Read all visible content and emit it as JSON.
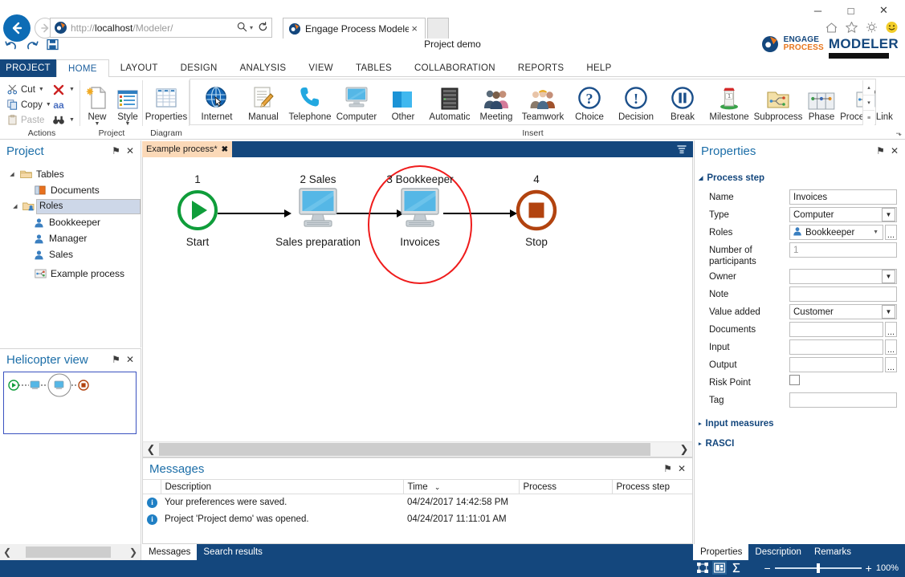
{
  "browser": {
    "url_prefix": "http://",
    "url_host": "localhost",
    "url_suffix": "/Modeler/",
    "url_full": "http://localhost/Modeler/",
    "tab_title": "Engage Process Modeler",
    "tab_close": "×",
    "back_icon": "←",
    "forward_icon": "→",
    "search_icon": "⌕",
    "caret_icon": "▾",
    "refresh_icon": "↻",
    "minimize": "─",
    "maximize": "□",
    "close": "✕",
    "home_icon": "⌂",
    "favorites_icon": "☆",
    "settings_icon": "⚙",
    "smiley_icon": "☺"
  },
  "app": {
    "project_demo": "Project demo",
    "brand_line1": "ENGAGE",
    "brand_line2": "PROCESS",
    "brand_modeler": "MODELER",
    "undo_icon": "↶",
    "redo_icon": "↷",
    "save_icon": "Ὃe"
  },
  "ribbon": {
    "tabs": [
      {
        "label": "PROJECT",
        "state": "project"
      },
      {
        "label": "HOME",
        "state": "active"
      },
      {
        "label": "LAYOUT",
        "state": ""
      },
      {
        "label": "DESIGN",
        "state": ""
      },
      {
        "label": "ANALYSIS",
        "state": ""
      },
      {
        "label": "VIEW",
        "state": ""
      },
      {
        "label": "TABLES",
        "state": ""
      },
      {
        "label": "COLLABORATION",
        "state": ""
      },
      {
        "label": "REPORTS",
        "state": ""
      },
      {
        "label": "HELP",
        "state": ""
      }
    ],
    "groups": {
      "actions": {
        "label": "Actions",
        "cut": "Cut",
        "copy": "Copy",
        "paste": "Paste",
        "delete_icon": "✕",
        "font_icon": "aa",
        "find_icon": "🔭"
      },
      "project": {
        "label": "Project",
        "new": "New",
        "style": "Style"
      },
      "diagram": {
        "label": "Diagram",
        "properties": "Properties"
      },
      "insert": {
        "label": "Insert",
        "items": [
          {
            "label": "Internet",
            "icon": "globe-icon"
          },
          {
            "label": "Manual",
            "icon": "manual-icon"
          },
          {
            "label": "Telephone",
            "icon": "telephone-icon"
          },
          {
            "label": "Computer",
            "icon": "computer-icon"
          },
          {
            "label": "Other",
            "icon": "other-icon"
          },
          {
            "label": "Automatic",
            "icon": "server-icon"
          },
          {
            "label": "Meeting",
            "icon": "meeting-icon"
          },
          {
            "label": "Teamwork",
            "icon": "teamwork-icon"
          },
          {
            "label": "Choice",
            "icon": "question-icon"
          },
          {
            "label": "Decision",
            "icon": "exclamation-icon"
          },
          {
            "label": "Break",
            "icon": "pause-icon"
          },
          {
            "label": "Milestone",
            "icon": "milestone-icon"
          },
          {
            "label": "Subprocess",
            "icon": "subprocess-icon"
          },
          {
            "label": "Phase",
            "icon": "phase-icon"
          },
          {
            "label": "Process Link",
            "icon": "process-link-icon"
          }
        ]
      }
    },
    "scroll_up": "▴",
    "scroll_down": "▾",
    "scroll_more": "≡",
    "dialog_launcher": "⬎"
  },
  "project_panel": {
    "title": "Project",
    "pin_icon": "⚑",
    "close_icon": "✕",
    "tree": [
      {
        "label": "Tables",
        "depth": 0,
        "arrow": "◢",
        "icon": "folder-icon",
        "selected": false
      },
      {
        "label": "Documents",
        "depth": 1,
        "arrow": "",
        "icon": "table-icon",
        "selected": false
      },
      {
        "label": "Roles",
        "depth": 1,
        "arrow": "◢",
        "icon": "roles-table-icon",
        "selected": true
      },
      {
        "label": "Bookkeeper",
        "depth": 2,
        "arrow": "",
        "icon": "person-icon",
        "selected": false
      },
      {
        "label": "Manager",
        "depth": 2,
        "arrow": "",
        "icon": "person-icon",
        "selected": false
      },
      {
        "label": "Sales",
        "depth": 2,
        "arrow": "",
        "icon": "person-icon",
        "selected": false
      },
      {
        "label": "Example process",
        "depth": 1,
        "arrow": "",
        "icon": "process-icon",
        "selected": false
      }
    ]
  },
  "helicopter_panel": {
    "title": "Helicopter view",
    "pin_icon": "⚑",
    "close_icon": "✕"
  },
  "diagram": {
    "tab_label": "Example process*",
    "tab_close": "✖",
    "menu_icon": "☰",
    "nodes": [
      {
        "num": "1",
        "label": "Start",
        "type": "start"
      },
      {
        "num": "2 Sales",
        "label": "Sales preparation",
        "type": "computer"
      },
      {
        "num": "3 Bookkeeper",
        "label": "Invoices",
        "type": "computer",
        "selected": true
      },
      {
        "num": "4",
        "label": "Stop",
        "type": "stop"
      }
    ],
    "selection_color": "#ef1c1c",
    "scroll_left": "‹",
    "scroll_right": "›"
  },
  "messages": {
    "title": "Messages",
    "pin_icon": "⚑",
    "close_icon": "✕",
    "columns": [
      "",
      "Description",
      "Time",
      "Process",
      "Process step"
    ],
    "sort_icon": "⌄",
    "rows": [
      {
        "icon": "info-icon",
        "description": "Your preferences were saved.",
        "time": "04/24/2017 14:42:58 PM",
        "process": "",
        "process_step": ""
      },
      {
        "icon": "info-icon",
        "description": "Project 'Project demo' was opened.",
        "time": "04/24/2017 11:11:01 AM",
        "process": "",
        "process_step": ""
      }
    ],
    "tabs": [
      {
        "label": "Messages",
        "active": true
      },
      {
        "label": "Search results",
        "active": false
      }
    ]
  },
  "properties": {
    "title": "Properties",
    "pin_icon": "⚑",
    "close_icon": "✕",
    "sections": [
      {
        "label": "Process step",
        "expanded": true,
        "tri": "◢"
      },
      {
        "label": "Input measures",
        "expanded": false,
        "tri": "▸"
      },
      {
        "label": "RASCI",
        "expanded": false,
        "tri": "▸"
      }
    ],
    "fields": [
      {
        "label": "Name",
        "kind": "text",
        "value": "Invoices",
        "placeholder": ""
      },
      {
        "label": "Type",
        "kind": "select",
        "value": "Computer"
      },
      {
        "label": "Roles",
        "kind": "combo",
        "value": "Bookkeeper",
        "icon": "person-icon",
        "ellipsis": "..."
      },
      {
        "label": "Number of participants",
        "kind": "text",
        "value": "",
        "placeholder": "1"
      },
      {
        "label": "Owner",
        "kind": "select",
        "value": ""
      },
      {
        "label": "Note",
        "kind": "text",
        "value": "",
        "placeholder": ""
      },
      {
        "label": "Value added",
        "kind": "select",
        "value": "Customer"
      },
      {
        "label": "Documents",
        "kind": "text-ellipsis",
        "value": "",
        "ellipsis": "..."
      },
      {
        "label": "Input",
        "kind": "text-ellipsis",
        "value": "",
        "ellipsis": "..."
      },
      {
        "label": "Output",
        "kind": "text-ellipsis",
        "value": "",
        "ellipsis": "..."
      },
      {
        "label": "Risk Point",
        "kind": "checkbox",
        "value": ""
      },
      {
        "label": "Tag",
        "kind": "text",
        "value": "",
        "placeholder": ""
      }
    ],
    "dropdown_arrow": "⌄",
    "tabs": [
      {
        "label": "Properties",
        "active": true
      },
      {
        "label": "Description",
        "active": false
      },
      {
        "label": "Remarks",
        "active": false
      }
    ]
  },
  "statusbar": {
    "icons": [
      {
        "name": "fit-page-icon",
        "glyph": "✥",
        "active": false
      },
      {
        "name": "fit-width-icon",
        "glyph": "⬚",
        "active": true
      },
      {
        "name": "sum-icon",
        "glyph": "Σ",
        "active": false
      }
    ],
    "zoom_minus": "−",
    "zoom_plus": "+",
    "zoom_value": "100%"
  },
  "colors": {
    "accent_dark_blue": "#14477d",
    "accent_blue": "#1c6ea8",
    "selection_red": "#ef1c1c",
    "start_green": "#0f9d3a",
    "stop_brown": "#b2430f",
    "monitor_blue": "#55b7e6",
    "tab_orange": "#fbd9b8"
  }
}
